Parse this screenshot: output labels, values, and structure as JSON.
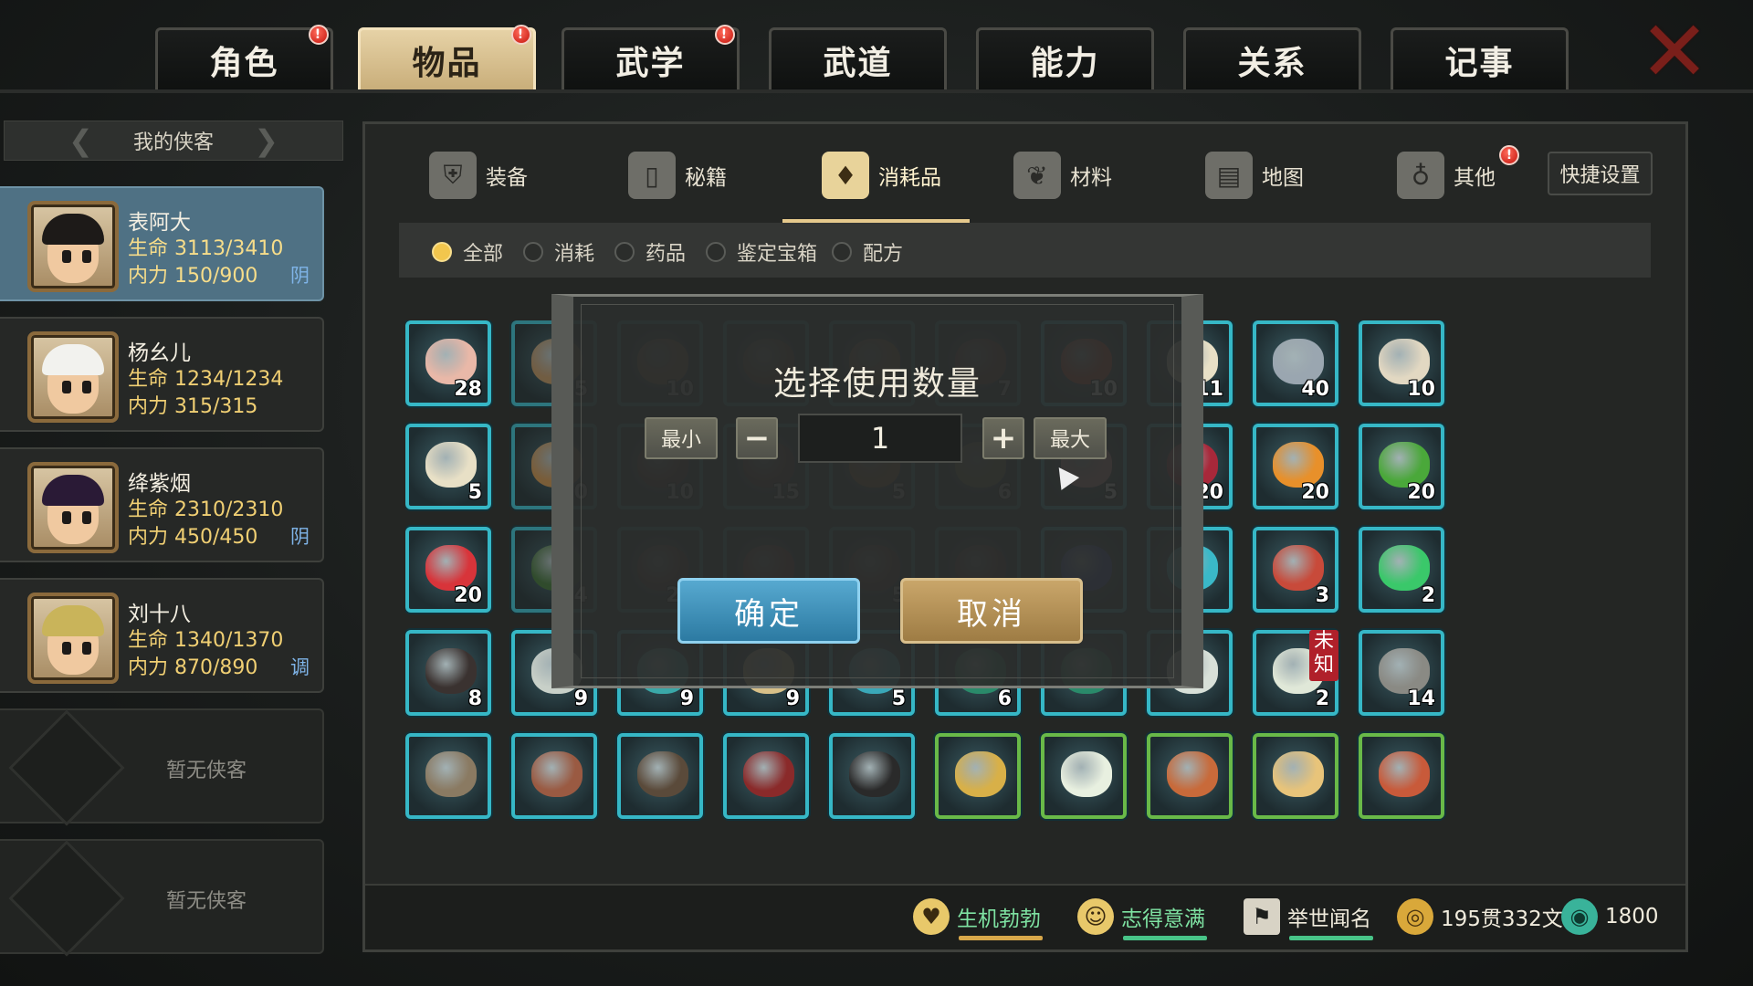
{
  "top_tabs": [
    {
      "label": "角色",
      "alert": true
    },
    {
      "label": "物品",
      "alert": true,
      "active": true
    },
    {
      "label": "武学",
      "alert": true
    },
    {
      "label": "武道",
      "alert": false
    },
    {
      "label": "能力",
      "alert": false
    },
    {
      "label": "关系",
      "alert": false
    },
    {
      "label": "记事",
      "alert": false
    }
  ],
  "sidebar": {
    "header": "我的侠客",
    "heroes": [
      {
        "name": "表阿大",
        "hp": "生命 3113/3410",
        "mp": "内力 150/900",
        "tag": "阴",
        "active": true
      },
      {
        "name": "杨幺儿",
        "hp": "生命 1234/1234",
        "mp": "内力 315/315",
        "tag": ""
      },
      {
        "name": "绛紫烟",
        "hp": "生命 2310/2310",
        "mp": "内力 450/450",
        "tag": "阴"
      },
      {
        "name": "刘十八",
        "hp": "生命 1340/1370",
        "mp": "内力 870/890",
        "tag": "调"
      }
    ],
    "empty_label": "暂无侠客"
  },
  "sub_tabs": [
    {
      "label": "装备",
      "icon": "armor-icon"
    },
    {
      "label": "秘籍",
      "icon": "book-icon"
    },
    {
      "label": "消耗品",
      "icon": "potion-icon",
      "active": true
    },
    {
      "label": "材料",
      "icon": "herb-icon"
    },
    {
      "label": "地图",
      "icon": "map-icon"
    },
    {
      "label": "其他",
      "icon": "bell-icon",
      "alert": true
    }
  ],
  "quick_settings": "快捷设置",
  "filters": [
    {
      "label": "全部",
      "on": true
    },
    {
      "label": "消耗",
      "on": false
    },
    {
      "label": "药品",
      "on": false
    },
    {
      "label": "鉴定宝箱",
      "on": false
    },
    {
      "label": "配方",
      "on": false
    }
  ],
  "items": [
    [
      "28",
      "5",
      "10",
      "",
      "5",
      "7",
      "10",
      "11",
      "40",
      "10"
    ],
    [
      "5",
      "10",
      "10",
      "15",
      "5",
      "6",
      "5",
      "20",
      "20",
      "20"
    ],
    [
      "20",
      "24",
      "21",
      "8",
      "5",
      "",
      "",
      "",
      "3",
      "2"
    ],
    [
      "8",
      "9",
      "9",
      "9",
      "5",
      "6",
      "",
      "",
      "2",
      "14"
    ],
    [
      "",
      "",
      "",
      "",
      "",
      "",
      "",
      "",
      "",
      ""
    ]
  ],
  "unknown_tag": "未知",
  "modal": {
    "title": "选择使用数量",
    "min_label": "最小",
    "minus": "−",
    "value": "1",
    "plus": "+",
    "max_label": "最大",
    "confirm": "确定",
    "cancel": "取消"
  },
  "status": {
    "health_state": "生机勃勃",
    "mood_state": "志得意满",
    "fame_state": "举世闻名",
    "money": "195贯332文",
    "jade": "1800"
  },
  "colors": {
    "accent_gold": "#e6c98c",
    "slot_cyan": "#36b7c6",
    "slot_green": "#69b948",
    "confirm_blue": "#3c8fb8",
    "cancel_gold": "#b8925a"
  }
}
